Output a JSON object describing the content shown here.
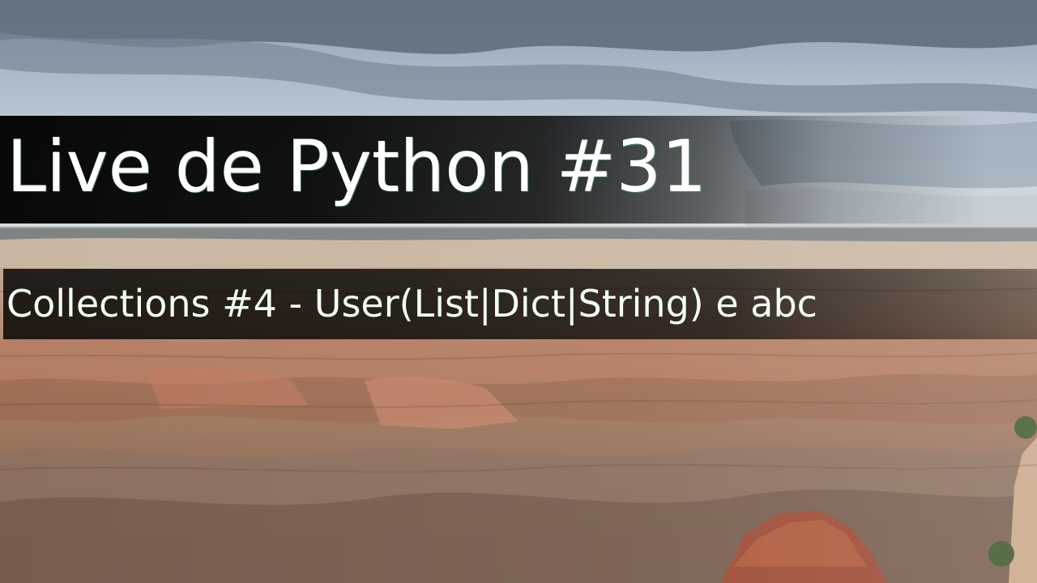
{
  "title": "Live de Python #31",
  "subtitle": "Collections #4 - User(List|Dict|String) e abc",
  "colors": {
    "sky": "#9fb2c2",
    "cloud": "#5f6e7c",
    "canyon_light": "#c9b39c",
    "canyon_red": "#a4614a",
    "band": "#000000",
    "text": "#ffffff"
  }
}
